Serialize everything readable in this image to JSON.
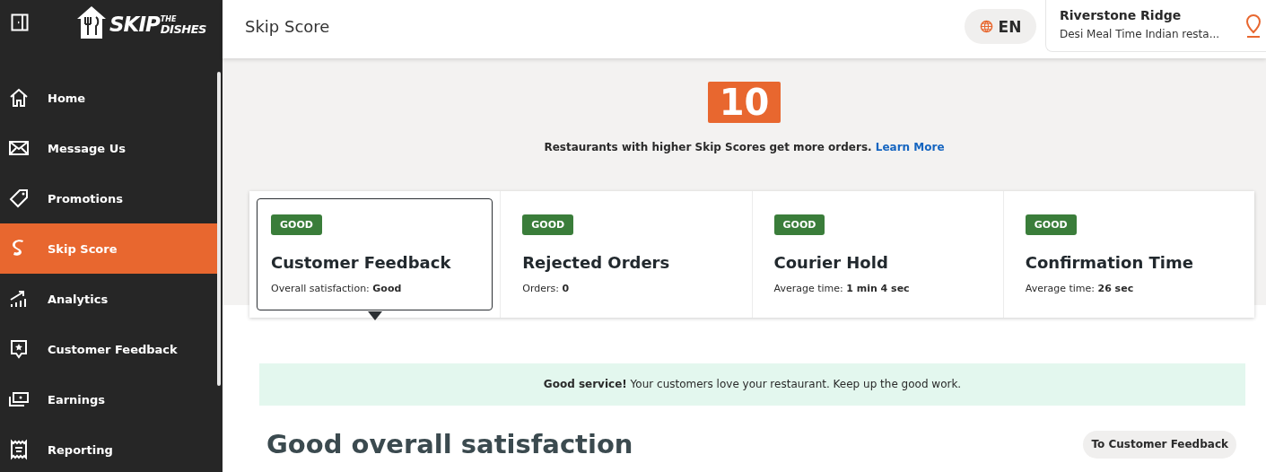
{
  "logo": {
    "main": "SKIP",
    "top": "THE",
    "bottom": "DISHES"
  },
  "sidebar": {
    "items": [
      {
        "label": "Home",
        "selected": false
      },
      {
        "label": "Message Us",
        "selected": false
      },
      {
        "label": "Promotions",
        "selected": false
      },
      {
        "label": "Skip Score",
        "selected": true
      },
      {
        "label": "Analytics",
        "selected": false
      },
      {
        "label": "Customer Feedback",
        "selected": false
      },
      {
        "label": "Earnings",
        "selected": false
      },
      {
        "label": "Reporting",
        "selected": false
      }
    ]
  },
  "header": {
    "title": "Skip Score",
    "language": "EN",
    "location": {
      "name": "Riverstone Ridge",
      "restaurant": "Desi Meal Time Indian resta..."
    }
  },
  "score": {
    "value": "10",
    "text": "Restaurants with higher Skip Scores get more orders.",
    "link": "Learn More"
  },
  "metrics": [
    {
      "badge": "GOOD",
      "title": "Customer Feedback",
      "label": "Overall satisfaction:",
      "value": "Good",
      "selected": true
    },
    {
      "badge": "GOOD",
      "title": "Rejected Orders",
      "label": "Orders:",
      "value": "0",
      "selected": false
    },
    {
      "badge": "GOOD",
      "title": "Courier Hold",
      "label": "Average time:",
      "value": "1 min 4 sec",
      "selected": false
    },
    {
      "badge": "GOOD",
      "title": "Confirmation Time",
      "label": "Average time:",
      "value": "26 sec",
      "selected": false
    }
  ],
  "banner": "**Good service!** Your customers love your restaurant. Keep up the good work.",
  "section": {
    "title": "Good overall satisfaction",
    "button": "To Customer Feedback"
  }
}
